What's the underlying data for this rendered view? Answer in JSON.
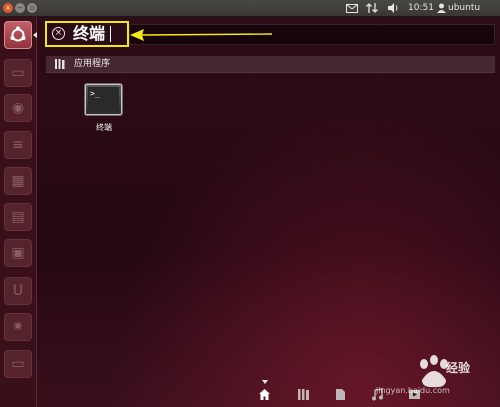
{
  "top_panel": {
    "time": "10:51",
    "user": "ubuntu",
    "icons": [
      "mail-icon",
      "network-arrows-icon",
      "volume-icon",
      "user-icon"
    ]
  },
  "search": {
    "query": "终端"
  },
  "category": {
    "label": "应用程序"
  },
  "results": [
    {
      "label": "终端",
      "icon": "terminal-icon",
      "prompt": ">_"
    }
  ],
  "launcher": {
    "icons": [
      "dash-home-icon",
      "files-icon",
      "browser-icon",
      "document-icon",
      "spreadsheet-icon",
      "presentation-icon",
      "software-center-icon",
      "ubuntu-one-icon",
      "system-settings-icon",
      "terminal-icon"
    ]
  },
  "lenses": {
    "icons": [
      "home-lens-icon",
      "applications-lens-icon",
      "files-lens-icon",
      "music-lens-icon",
      "video-lens-icon"
    ]
  },
  "watermark": {
    "text": "经验",
    "url": "jingyan.baidu.com"
  },
  "colors": {
    "highlight": "#f3e81c",
    "panel": "#3c3b37",
    "dash_bg": "#2a0a14"
  }
}
